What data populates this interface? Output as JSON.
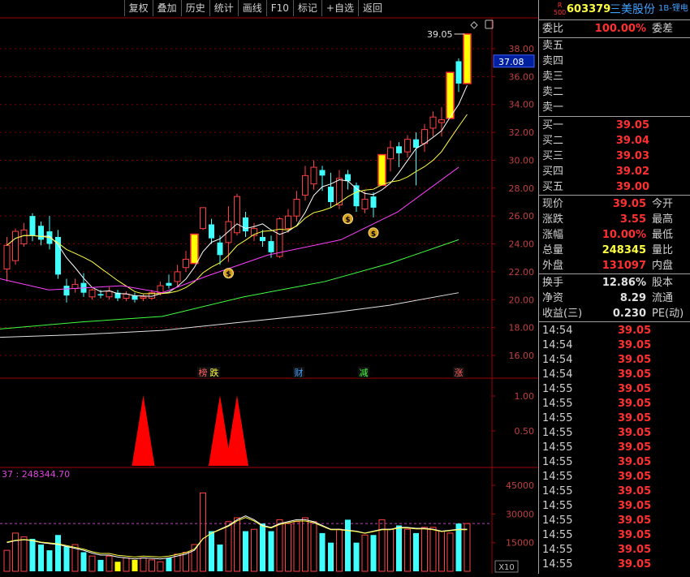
{
  "toolbar": {
    "buttons": [
      "复权",
      "叠加",
      "历史",
      "统计",
      "画线",
      "F10",
      "标记",
      "+自选",
      "返回"
    ]
  },
  "stock": {
    "badge_top": "R",
    "badge_bottom": "500",
    "code": "603379",
    "name": "三美股份",
    "tag": "1B-锂电"
  },
  "order_ratio": {
    "label": "委比",
    "value": "100.00%",
    "label2": "委差"
  },
  "sell": [
    {
      "label": "卖五",
      "price": ""
    },
    {
      "label": "卖四",
      "price": ""
    },
    {
      "label": "卖三",
      "price": ""
    },
    {
      "label": "卖二",
      "price": ""
    },
    {
      "label": "卖一",
      "price": ""
    }
  ],
  "buy": [
    {
      "label": "买一",
      "price": "39.05"
    },
    {
      "label": "买二",
      "price": "39.04"
    },
    {
      "label": "买三",
      "price": "39.03"
    },
    {
      "label": "买四",
      "price": "39.02"
    },
    {
      "label": "买五",
      "price": "39.00"
    }
  ],
  "stats": [
    {
      "label": "现价",
      "value": "39.05",
      "label2": "今开",
      "color": "red"
    },
    {
      "label": "涨跌",
      "value": "3.55",
      "label2": "最高",
      "color": "red"
    },
    {
      "label": "涨幅",
      "value": "10.00%",
      "label2": "最低",
      "color": "red"
    },
    {
      "label": "总量",
      "value": "248345",
      "label2": "量比",
      "color": "yellow"
    },
    {
      "label": "外盘",
      "value": "131097",
      "label2": "内盘",
      "color": "red"
    }
  ],
  "stats2": [
    {
      "label": "换手",
      "value": "12.86%",
      "label2": "股本",
      "color": "white"
    },
    {
      "label": "净资",
      "value": "8.29",
      "label2": "流通",
      "color": "white"
    },
    {
      "label": "收益(三)",
      "value": "0.230",
      "label2": "PE(动)",
      "color": "white"
    }
  ],
  "ticks": [
    {
      "time": "14:54",
      "price": "39.05"
    },
    {
      "time": "14:54",
      "price": "39.05"
    },
    {
      "time": "14:54",
      "price": "39.05"
    },
    {
      "time": "14:54",
      "price": "39.05"
    },
    {
      "time": "14:55",
      "price": "39.05"
    },
    {
      "time": "14:55",
      "price": "39.05"
    },
    {
      "time": "14:55",
      "price": "39.05"
    },
    {
      "time": "14:55",
      "price": "39.05"
    },
    {
      "time": "14:55",
      "price": "39.05"
    },
    {
      "time": "14:55",
      "price": "39.05"
    },
    {
      "time": "14:55",
      "price": "39.05"
    },
    {
      "time": "14:55",
      "price": "39.05"
    },
    {
      "time": "14:55",
      "price": "39.05"
    },
    {
      "time": "14:55",
      "price": "39.05"
    },
    {
      "time": "14:55",
      "price": "39.05"
    },
    {
      "time": "14:55",
      "price": "39.05"
    },
    {
      "time": "14:55",
      "price": "39.05"
    }
  ],
  "chart": {
    "price_axis": [
      "38.00",
      "36.00",
      "34.00",
      "32.00",
      "30.00",
      "28.00",
      "26.00",
      "24.00",
      "22.00",
      "20.00",
      "18.00",
      "16.00"
    ],
    "current_price_tag": "37.08",
    "high_label": "39.05",
    "events": [
      {
        "text": "榜",
        "color": "#ff6060"
      },
      {
        "text": "跌",
        "color": "#ffff40"
      },
      {
        "text": "财",
        "color": "#40a0ff"
      },
      {
        "text": "减",
        "color": "#40ff40"
      },
      {
        "text": "涨",
        "color": "#ff6060"
      }
    ],
    "indicator_axis": [
      "1.00",
      "0.50"
    ],
    "volume_label": "37 : 248344.70",
    "volume_axis": [
      "45000",
      "30000",
      "15000"
    ],
    "volume_unit": "X10",
    "candles": [
      {
        "o": 22.2,
        "c": 23.9,
        "h": 24.5,
        "l": 21.3
      },
      {
        "o": 22.8,
        "c": 24.9,
        "h": 25.1,
        "l": 22.5
      },
      {
        "o": 24.0,
        "c": 25.0,
        "h": 25.5,
        "l": 23.8
      },
      {
        "o": 26.0,
        "c": 24.6,
        "h": 26.2,
        "l": 24.2
      },
      {
        "o": 25.3,
        "c": 24.3,
        "h": 25.6,
        "l": 23.9
      },
      {
        "o": 24.9,
        "c": 24.0,
        "h": 26.0,
        "l": 23.6
      },
      {
        "o": 24.5,
        "c": 21.8,
        "h": 25.0,
        "l": 21.5
      },
      {
        "o": 21.0,
        "c": 20.3,
        "h": 21.5,
        "l": 19.8
      },
      {
        "o": 20.8,
        "c": 21.1,
        "h": 21.5,
        "l": 20.5
      },
      {
        "o": 21.2,
        "c": 20.5,
        "h": 21.9,
        "l": 20.2
      },
      {
        "o": 20.2,
        "c": 20.7,
        "h": 20.8,
        "l": 20.0
      },
      {
        "o": 20.4,
        "c": 20.3,
        "h": 20.7,
        "l": 20.1
      },
      {
        "o": 20.2,
        "c": 20.6,
        "h": 20.9,
        "l": 20.0
      },
      {
        "o": 20.5,
        "c": 20.1,
        "h": 20.7,
        "l": 19.9
      },
      {
        "o": 20.1,
        "c": 20.4,
        "h": 20.6,
        "l": 19.9
      },
      {
        "o": 20.3,
        "c": 20.0,
        "h": 20.5,
        "l": 19.8
      },
      {
        "o": 20.1,
        "c": 20.2,
        "h": 20.4,
        "l": 19.9
      },
      {
        "o": 20.1,
        "c": 20.5,
        "h": 20.7,
        "l": 20.0
      },
      {
        "o": 20.5,
        "c": 21.0,
        "h": 21.3,
        "l": 20.3
      },
      {
        "o": 21.2,
        "c": 21.0,
        "h": 21.8,
        "l": 20.8
      },
      {
        "o": 21.3,
        "c": 22.0,
        "h": 22.5,
        "l": 21.0
      },
      {
        "o": 22.3,
        "c": 22.9,
        "h": 23.5,
        "l": 22.0
      },
      {
        "o": 22.6,
        "c": 24.7,
        "h": 24.7,
        "l": 22.6
      },
      {
        "o": 25.1,
        "c": 26.6,
        "h": 26.6,
        "l": 25.0
      },
      {
        "o": 25.4,
        "c": 24.4,
        "h": 25.8,
        "l": 24.0
      },
      {
        "o": 24.1,
        "c": 23.2,
        "h": 24.6,
        "l": 22.5
      },
      {
        "o": 24.1,
        "c": 25.6,
        "h": 26.7,
        "l": 22.7
      },
      {
        "o": 24.8,
        "c": 27.4,
        "h": 27.6,
        "l": 24.6
      },
      {
        "o": 25.9,
        "c": 24.9,
        "h": 26.3,
        "l": 24.5
      },
      {
        "o": 24.6,
        "c": 25.1,
        "h": 25.5,
        "l": 24.2
      },
      {
        "o": 24.5,
        "c": 24.2,
        "h": 25.0,
        "l": 23.8
      },
      {
        "o": 24.2,
        "c": 23.4,
        "h": 24.6,
        "l": 23.0
      },
      {
        "o": 23.1,
        "c": 25.8,
        "h": 25.9,
        "l": 23.0
      },
      {
        "o": 25.1,
        "c": 26.0,
        "h": 26.5,
        "l": 24.8
      },
      {
        "o": 26.0,
        "c": 27.2,
        "h": 27.8,
        "l": 25.6
      },
      {
        "o": 27.5,
        "c": 28.9,
        "h": 29.6,
        "l": 27.1
      },
      {
        "o": 28.3,
        "c": 29.5,
        "h": 30.0,
        "l": 27.9
      },
      {
        "o": 29.3,
        "c": 28.9,
        "h": 29.6,
        "l": 27.8
      },
      {
        "o": 28.1,
        "c": 27.0,
        "h": 29.1,
        "l": 26.6
      },
      {
        "o": 26.8,
        "c": 28.7,
        "h": 29.3,
        "l": 26.5
      },
      {
        "o": 29.0,
        "c": 28.5,
        "h": 29.3,
        "l": 27.9
      },
      {
        "o": 28.2,
        "c": 26.7,
        "h": 28.4,
        "l": 26.3
      },
      {
        "o": 26.5,
        "c": 27.2,
        "h": 27.8,
        "l": 26.2
      },
      {
        "o": 27.4,
        "c": 26.6,
        "h": 27.7,
        "l": 25.9
      },
      {
        "o": 28.2,
        "c": 30.4,
        "h": 30.4,
        "l": 28.2
      },
      {
        "o": 30.1,
        "c": 30.9,
        "h": 31.4,
        "l": 29.2
      },
      {
        "o": 31.0,
        "c": 30.5,
        "h": 31.3,
        "l": 29.5
      },
      {
        "o": 30.6,
        "c": 31.5,
        "h": 31.8,
        "l": 30.2
      },
      {
        "o": 31.5,
        "c": 30.9,
        "h": 32.0,
        "l": 28.2
      },
      {
        "o": 31.2,
        "c": 32.2,
        "h": 32.6,
        "l": 30.6
      },
      {
        "o": 32.3,
        "c": 33.1,
        "h": 33.5,
        "l": 31.7
      },
      {
        "o": 32.7,
        "c": 32.9,
        "h": 33.8,
        "l": 31.7
      },
      {
        "o": 33.0,
        "c": 36.3,
        "h": 36.3,
        "l": 33.0
      },
      {
        "o": 37.1,
        "c": 35.5,
        "h": 37.3,
        "l": 34.9
      },
      {
        "o": 35.5,
        "c": 39.05,
        "h": 39.05,
        "l": 35.5
      }
    ],
    "volumes": [
      11000,
      20000,
      18000,
      17000,
      14000,
      11000,
      19000,
      13000,
      14000,
      10000,
      8000,
      6000,
      8000,
      5000,
      7000,
      6000,
      7000,
      6000,
      5000,
      7000,
      9000,
      10000,
      14000,
      41000,
      21000,
      14000,
      26000,
      28000,
      21000,
      22000,
      25000,
      21000,
      27000,
      25000,
      26000,
      28000,
      26000,
      20000,
      15000,
      22000,
      27000,
      15000,
      19000,
      19000,
      27000,
      22000,
      24000,
      22000,
      20000,
      23000,
      23000,
      21000,
      20000,
      25000,
      25000
    ],
    "vol_ma5": [
      15000,
      16000,
      16500,
      16000,
      15000,
      14500,
      14000,
      13000,
      12000,
      11000,
      9500,
      8500,
      8500,
      7500,
      7000,
      6500,
      7000,
      6800,
      6500,
      7000,
      8000,
      9000,
      11000,
      17000,
      20000,
      22000,
      24000,
      27000,
      29000,
      27000,
      24000,
      23000,
      25000,
      26000,
      27000,
      27000,
      26000,
      24000,
      22000,
      22000,
      21500,
      21000,
      20000,
      21000,
      22000,
      22000,
      23000,
      23000,
      22500,
      22500,
      22000,
      21000,
      21500,
      22000,
      22000
    ],
    "ind_spikes": [
      16,
      25,
      27
    ]
  }
}
